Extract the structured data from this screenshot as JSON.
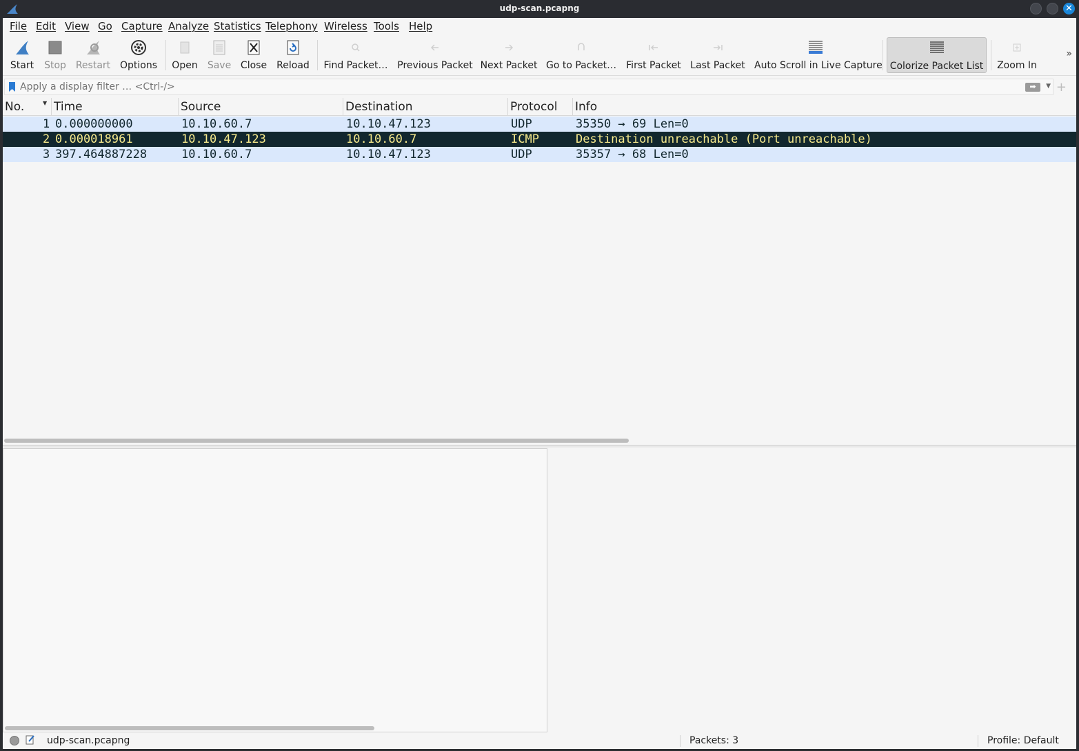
{
  "window": {
    "title": "udp-scan.pcapng",
    "accent_color": "#1a86d8"
  },
  "menu": [
    "File",
    "Edit",
    "View",
    "Go",
    "Capture",
    "Analyze",
    "Statistics",
    "Telephony",
    "Wireless",
    "Tools",
    "Help"
  ],
  "toolbar": {
    "start": "Start",
    "stop": "Stop",
    "restart": "Restart",
    "options": "Options",
    "open": "Open",
    "save": "Save",
    "close": "Close",
    "reload": "Reload",
    "find": "Find Packet…",
    "prev": "Previous Packet",
    "next": "Next Packet",
    "goto": "Go to Packet…",
    "first": "First Packet",
    "last": "Last Packet",
    "autoscroll": "Auto Scroll in Live Capture",
    "colorize": "Colorize Packet List",
    "zoom_in": "Zoom In",
    "overflow": "»"
  },
  "filter": {
    "placeholder": "Apply a display filter … <Ctrl-/>",
    "plus": "+"
  },
  "packet_list": {
    "columns": [
      "No.",
      "Time",
      "Source",
      "Destination",
      "Protocol",
      "Info"
    ],
    "rows": [
      {
        "no": "1",
        "time": "0.000000000",
        "source": "10.10.60.7",
        "destination": "10.10.47.123",
        "protocol": "UDP",
        "info": "35350 → 69 Len=0",
        "selected": false
      },
      {
        "no": "2",
        "time": "0.000018961",
        "source": "10.10.47.123",
        "destination": "10.10.60.7",
        "protocol": "ICMP",
        "info": "Destination unreachable (Port unreachable)",
        "selected": true
      },
      {
        "no": "3",
        "time": "397.464887228",
        "source": "10.10.60.7",
        "destination": "10.10.47.123",
        "protocol": "UDP",
        "info": "35357 → 68 Len=0",
        "selected": false
      }
    ],
    "row_color": "#dae8fc",
    "selected_row_color": "#12272e",
    "selected_text_color": "#f7ea8c"
  },
  "status": {
    "file": "udp-scan.pcapng",
    "packets": "Packets: 3",
    "profile": "Profile: Default"
  }
}
